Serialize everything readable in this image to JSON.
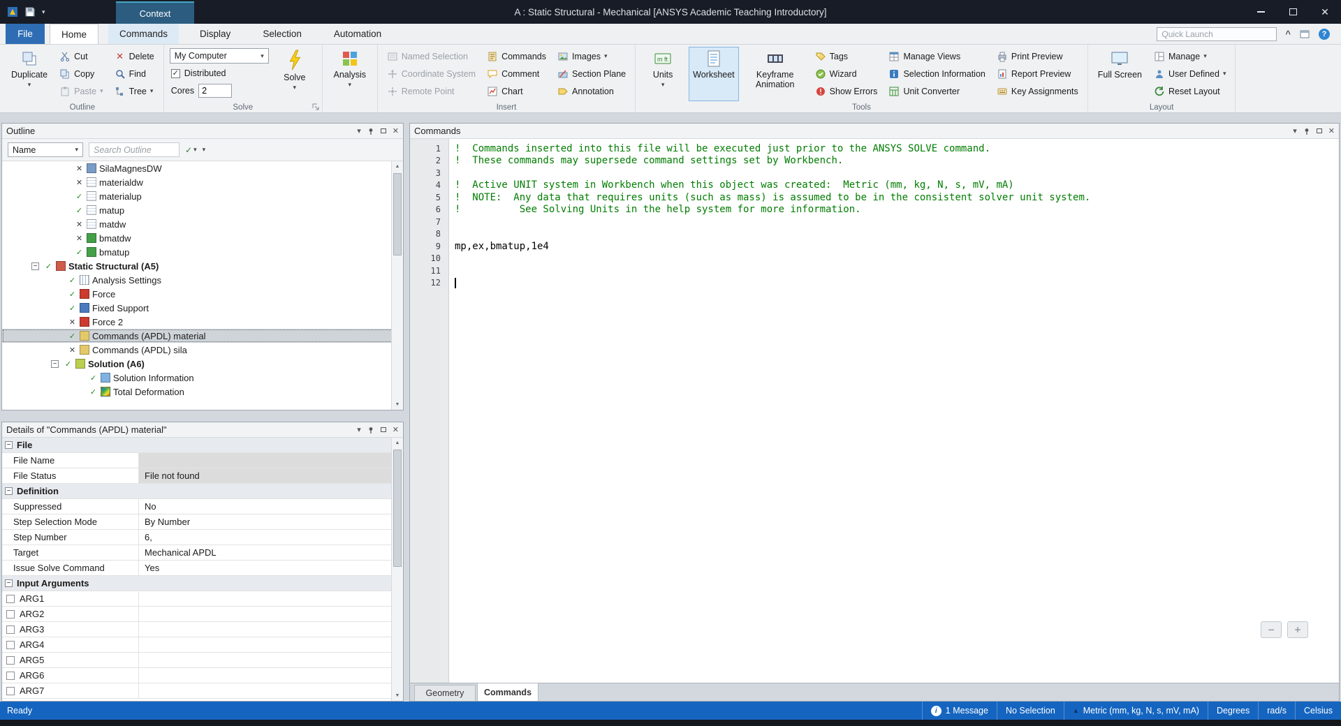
{
  "window": {
    "title": "A : Static Structural - Mechanical [ANSYS Academic Teaching Introductory]",
    "context_tab": "Context"
  },
  "icons": {
    "dropdown": "▾",
    "close": "✕",
    "check": "✓",
    "minus": "−",
    "plus": "+",
    "collapse": "^",
    "help": "?",
    "up_triangle": "▲",
    "scroll_up": "▲",
    "scroll_down": "▼",
    "info": "i"
  },
  "tabs": {
    "file": "File",
    "items": [
      "Home",
      "Commands",
      "Display",
      "Selection",
      "Automation"
    ],
    "quick_launch": "Quick Launch"
  },
  "ribbon": {
    "outline": {
      "label": "Outline",
      "duplicate": "Duplicate",
      "cut": "Cut",
      "copy": "Copy",
      "paste": "Paste",
      "delete": "Delete",
      "find": "Find",
      "tree": "Tree"
    },
    "solve": {
      "label": "Solve",
      "computer": "My Computer",
      "distributed": "Distributed",
      "cores": "Cores",
      "cores_value": "2",
      "solve": "Solve"
    },
    "analysis": {
      "button": "Analysis"
    },
    "insert": {
      "label": "Insert",
      "named_selection": "Named Selection",
      "coordinate_system": "Coordinate System",
      "remote_point": "Remote Point",
      "commands": "Commands",
      "comment": "Comment",
      "chart": "Chart",
      "images": "Images",
      "section_plane": "Section Plane",
      "annotation": "Annotation"
    },
    "tools": {
      "label": "Tools",
      "units": "Units",
      "worksheet": "Worksheet",
      "keyframe": "Keyframe Animation",
      "tags": "Tags",
      "wizard": "Wizard",
      "show_errors": "Show Errors",
      "manage_views": "Manage Views",
      "selection_information": "Selection Information",
      "unit_converter": "Unit Converter",
      "print_preview": "Print Preview",
      "report_preview": "Report Preview",
      "key_assignments": "Key Assignments"
    },
    "layout": {
      "label": "Layout",
      "full_screen": "Full Screen",
      "manage": "Manage",
      "user_defined": "User Defined",
      "reset_layout": "Reset Layout"
    }
  },
  "outline_panel": {
    "title": "Outline",
    "filter_name": "Name",
    "search_placeholder": "Search Outline",
    "tree": [
      {
        "label": "SilaMagnesDW",
        "mark": "✕"
      },
      {
        "label": "materialdw",
        "mark": "✕"
      },
      {
        "label": "materialup",
        "mark": "✓"
      },
      {
        "label": "matup",
        "mark": "✓"
      },
      {
        "label": "matdw",
        "mark": "✕"
      },
      {
        "label": "bmatdw",
        "mark": "✕"
      },
      {
        "label": "bmatup",
        "mark": "✓"
      },
      {
        "label": "Static Structural (A5)",
        "mark": "✓"
      },
      {
        "label": "Analysis Settings",
        "mark": "✓"
      },
      {
        "label": "Force",
        "mark": "✓"
      },
      {
        "label": "Fixed Support",
        "mark": "✓"
      },
      {
        "label": "Force 2",
        "mark": "✕"
      },
      {
        "label": "Commands (APDL) material",
        "mark": "✓"
      },
      {
        "label": "Commands (APDL) sila",
        "mark": "✕"
      },
      {
        "label": "Solution (A6)",
        "mark": "✓"
      },
      {
        "label": "Solution Information",
        "mark": "✓"
      },
      {
        "label": "Total Deformation",
        "mark": "✓"
      }
    ]
  },
  "details_panel": {
    "title": "Details of \"Commands (APDL) material\"",
    "rows": [
      {
        "label": "File",
        "value": ""
      },
      {
        "label": "File Name",
        "value": ""
      },
      {
        "label": "File Status",
        "value": "File not found"
      },
      {
        "label": "Definition",
        "value": ""
      },
      {
        "label": "Suppressed",
        "value": "No"
      },
      {
        "label": "Step Selection Mode",
        "value": "By Number"
      },
      {
        "label": "Step Number",
        "value": "6,"
      },
      {
        "label": "Target",
        "value": "Mechanical APDL"
      },
      {
        "label": "Issue Solve Command",
        "value": "Yes"
      },
      {
        "label": "Input Arguments",
        "value": ""
      },
      {
        "label": "ARG1",
        "value": ""
      },
      {
        "label": "ARG2",
        "value": ""
      },
      {
        "label": "ARG3",
        "value": ""
      },
      {
        "label": "ARG4",
        "value": ""
      },
      {
        "label": "ARG5",
        "value": ""
      },
      {
        "label": "ARG6",
        "value": ""
      },
      {
        "label": "ARG7",
        "value": ""
      }
    ]
  },
  "editor": {
    "panel_title": "Commands",
    "tabs": [
      "Geometry",
      "Commands"
    ],
    "lines": [
      {
        "n": "1",
        "text": "!  Commands inserted into this file will be executed just prior to the ANSYS SOLVE command."
      },
      {
        "n": "2",
        "text": "!  These commands may supersede command settings set by Workbench."
      },
      {
        "n": "3",
        "text": ""
      },
      {
        "n": "4",
        "text": "!  Active UNIT system in Workbench when this object was created:  Metric (mm, kg, N, s, mV, mA)"
      },
      {
        "n": "5",
        "text": "!  NOTE:  Any data that requires units (such as mass) is assumed to be in the consistent solver unit system."
      },
      {
        "n": "6",
        "text": "!          See Solving Units in the help system for more information."
      },
      {
        "n": "7",
        "text": ""
      },
      {
        "n": "8",
        "text": ""
      },
      {
        "n": "9",
        "text": "mp,ex,bmatup,1e4"
      },
      {
        "n": "10",
        "text": ""
      },
      {
        "n": "11",
        "text": ""
      },
      {
        "n": "12",
        "text": ""
      }
    ]
  },
  "statusbar": {
    "ready": "Ready",
    "messages": "1 Message",
    "selection": "No Selection",
    "units": "Metric (mm, kg, N, s, mV, mA)",
    "angle": "Degrees",
    "angular_velocity": "rad/s",
    "temperature": "Celsius"
  },
  "colors": {
    "titlebar_bg": "#171c26",
    "context_tab_bg": "#2c5d80",
    "file_tab_bg": "#2e6db4",
    "statusbar_bg": "#1565c0",
    "comment_green": "#007d00",
    "active_button_bg": "#d8e9f7",
    "selected_row_bg": "#cfd4d9"
  }
}
